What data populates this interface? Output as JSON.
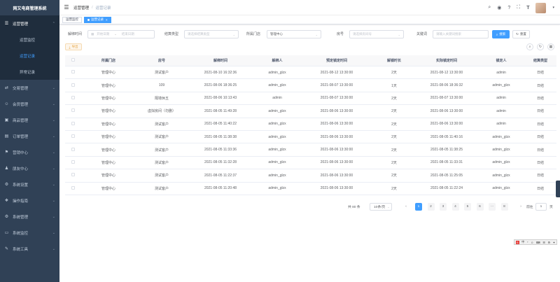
{
  "app": {
    "title": "网又电商管理系统"
  },
  "sidebar": {
    "items": [
      {
        "label": "运营管理",
        "icon": "list-icon",
        "open": true,
        "children": [
          {
            "label": "运营监控",
            "active": false
          },
          {
            "label": "运营记录",
            "active": true
          },
          {
            "label": "异常记录",
            "active": false
          }
        ]
      },
      {
        "label": "交易管理",
        "icon": "exchange-icon"
      },
      {
        "label": "会员管理",
        "icon": "user-icon"
      },
      {
        "label": "商品管理",
        "icon": "goods-icon"
      },
      {
        "label": "订单管理",
        "icon": "order-icon"
      },
      {
        "label": "营销中心",
        "icon": "marketing-icon"
      },
      {
        "label": "朋友中心",
        "icon": "friend-icon"
      },
      {
        "label": "系统设置",
        "icon": "gear-icon"
      },
      {
        "label": "操作指南",
        "icon": "guide-icon"
      },
      {
        "label": "系统管理",
        "icon": "system-icon"
      },
      {
        "label": "系统监控",
        "icon": "monitor-icon"
      },
      {
        "label": "系统工具",
        "icon": "tools-icon"
      }
    ]
  },
  "header": {
    "breadcrumb": [
      "运营管理",
      "运营记录"
    ],
    "icons": [
      "search-icon",
      "github-icon",
      "help-icon",
      "fullscreen-icon",
      "font-size-icon"
    ]
  },
  "tags": [
    {
      "label": "运营监控",
      "active": false
    },
    {
      "label": "运营记录",
      "active": true
    }
  ],
  "search": {
    "unbind_time_label": "解绑时间",
    "start_date_placeholder": "开始日期",
    "range_sep": "-",
    "end_date_placeholder": "结束日期",
    "settle_type_label": "结算类型",
    "settle_type_placeholder": "请选择结算类型",
    "store_label": "所属门店",
    "store_value": "管理中心",
    "room_label": "房号",
    "room_placeholder": "请选择房间号",
    "keyword_label": "关键词",
    "keyword_placeholder": "请输入关键词搜索",
    "search_btn": "搜索",
    "reset_btn": "重置"
  },
  "toolbar": {
    "export_label": "导出"
  },
  "table": {
    "columns": [
      "所属门店",
      "房号",
      "解绑时间",
      "解绑人",
      "预定锁定时间",
      "解锁时长",
      "实际锁定时间",
      "锁定人",
      "结算类型"
    ],
    "rows": [
      [
        "管理中心",
        "测试客户",
        "2021-08-10 16:32:36",
        "admin_glzx",
        "2021-08-12 13:30:00",
        "2天",
        "2021-08-12 13:30:00",
        "admin",
        "日结"
      ],
      [
        "管理中心",
        "109",
        "2021-08-06 18:36:25",
        "admin_glzx",
        "2021-08-07 13:30:00",
        "1天",
        "2021-08-06 18:36:32",
        "admin_glzx",
        "日结"
      ],
      [
        "管理中心",
        "隔墙休五",
        "2021-08-06 10:13:43",
        "admin",
        "2021-08-07 13:30:00",
        "2天",
        "2021-08-07 13:30:00",
        "admin",
        "日结"
      ],
      [
        "管理中心",
        "虚拟房间（勿删）",
        "2021-08-05 11:49:28",
        "admin_glzx",
        "2021-08-06 13:30:00",
        "2天",
        "2021-08-06 13:30:00",
        "admin",
        "日结"
      ],
      [
        "管理中心",
        "测试客户",
        "2021-08-05 11:40:22",
        "admin_glzx",
        "2021-08-06 13:30:00",
        "2天",
        "2021-08-06 13:30:00",
        "admin",
        "日结"
      ],
      [
        "管理中心",
        "测试客户",
        "2021-08-05 11:38:38",
        "admin_glzx",
        "2021-08-06 13:30:00",
        "2天",
        "2021-08-05 11:40:16",
        "admin_glzx",
        "日结"
      ],
      [
        "管理中心",
        "测试客户",
        "2021-08-05 11:33:36",
        "admin_glzx",
        "2021-08-06 13:30:00",
        "2天",
        "2021-08-05 11:38:25",
        "admin_glzx",
        "日结"
      ],
      [
        "管理中心",
        "测试客户",
        "2021-08-05 11:32:28",
        "admin_glzx",
        "2021-08-06 13:30:00",
        "2天",
        "2021-08-05 11:33:31",
        "admin_glzx",
        "日结"
      ],
      [
        "管理中心",
        "测试客户",
        "2021-08-05 11:22:37",
        "admin_glzx",
        "2021-08-06 13:30:00",
        "2天",
        "2021-08-05 11:25:05",
        "admin_glzx",
        "日结"
      ],
      [
        "管理中心",
        "测试客户",
        "2021-08-05 11:20:48",
        "admin_glzx",
        "2021-08-06 13:30:00",
        "2天",
        "2021-08-05 11:22:24",
        "admin_glzx",
        "日结"
      ]
    ]
  },
  "pagination": {
    "total": "共 80 条",
    "page_size": "10条/页",
    "prev": "‹",
    "pages": [
      "1",
      "2",
      "3",
      "4",
      "5",
      "6",
      "···",
      "8"
    ],
    "current": "1",
    "next": "›",
    "goto_label": "前往",
    "goto_value": "1",
    "goto_unit": "页"
  },
  "ime": {
    "items": [
      "S",
      "中",
      "°",
      "☺",
      "⌨",
      "☰",
      "⚙",
      "✦"
    ]
  }
}
